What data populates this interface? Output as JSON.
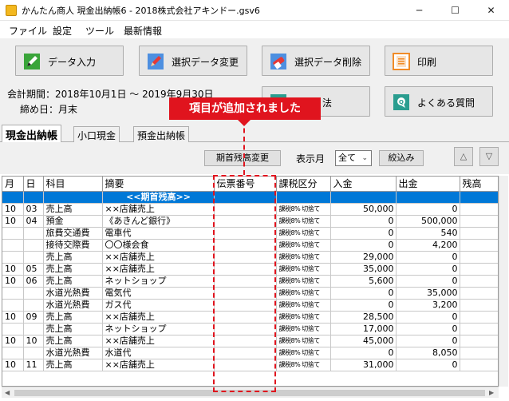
{
  "window": {
    "title": "かんたん商人 現金出納帳6 - 2018株式会社アキンドー.gsv6",
    "minimize": "─",
    "maximize": "☐",
    "close": "✕"
  },
  "menu": [
    "ファイル",
    "設定",
    "ツール",
    "最新情報"
  ],
  "toolbar": {
    "data_input": "データ入力",
    "edit_data": "選択データ変更",
    "delete_data": "選択データ削除",
    "print": "印刷",
    "settings_partial": "法",
    "faq": "よくある質問"
  },
  "info": {
    "period": "会計期間：2018年10月1日 〜 2019年9月30日",
    "closing": "締め日：月末"
  },
  "tabs": [
    "現金出納帳",
    "小口現金",
    "預金出納帳"
  ],
  "filter": {
    "opening_balance_button": "期首残高変更",
    "month_label": "表示月",
    "month_value": "全て",
    "narrow_button": "絞込み",
    "up": "△",
    "down": "▽"
  },
  "callout": {
    "text": "項目が追加されました"
  },
  "table": {
    "headers": [
      "月",
      "日",
      "科目",
      "摘要",
      "伝票番号",
      "課税区分",
      "入金",
      "出金",
      "残高"
    ],
    "rows": [
      [
        "",
        "",
        "",
        "<<期首残高>>",
        "",
        "",
        "",
        "",
        "1,00"
      ],
      [
        "10",
        "03",
        "売上高",
        "××店舗売上",
        "",
        "課税8% 切捨て",
        "50,000",
        "0",
        "1,05"
      ],
      [
        "10",
        "04",
        "預金",
        "《あきんど銀行》",
        "",
        "課税8% 切捨て",
        "0",
        "500,000",
        ""
      ],
      [
        "",
        "",
        "旅費交通費",
        "電車代",
        "",
        "課税8% 切捨て",
        "0",
        "540",
        ""
      ],
      [
        "",
        "",
        "接待交際費",
        "〇〇様会食",
        "",
        "課税8% 切捨て",
        "0",
        "4,200",
        ""
      ],
      [
        "",
        "",
        "売上高",
        "××店舗売上",
        "",
        "課税8% 切捨て",
        "29,000",
        "0",
        "57"
      ],
      [
        "10",
        "05",
        "売上高",
        "××店舗売上",
        "",
        "課税8% 切捨て",
        "35,000",
        "0",
        "60"
      ],
      [
        "10",
        "06",
        "売上高",
        "ネットショップ",
        "",
        "課税8% 切捨て",
        "5,600",
        "0",
        ""
      ],
      [
        "",
        "",
        "水道光熱費",
        "電気代",
        "",
        "課税8% 切捨て",
        "0",
        "35,000",
        ""
      ],
      [
        "",
        "",
        "水道光熱費",
        "ガス代",
        "",
        "課税8% 切捨て",
        "0",
        "3,200",
        "57"
      ],
      [
        "10",
        "09",
        "売上高",
        "××店舗売上",
        "",
        "課税8% 切捨て",
        "28,500",
        "0",
        ""
      ],
      [
        "",
        "",
        "売上高",
        "ネットショップ",
        "",
        "課税8% 切捨て",
        "17,000",
        "0",
        "62"
      ],
      [
        "10",
        "10",
        "売上高",
        "××店舗売上",
        "",
        "課税8% 切捨て",
        "45,000",
        "0",
        ""
      ],
      [
        "",
        "",
        "水道光熱費",
        "水道代",
        "",
        "課税8% 切捨て",
        "0",
        "8,050",
        "65"
      ],
      [
        "10",
        "11",
        "売上高",
        "××店舗売上",
        "",
        "課税8% 切捨て",
        "31,000",
        "0",
        "68"
      ]
    ]
  },
  "icons": {
    "app": "app-icon",
    "data_input": "pencil-icon",
    "edit": "pencil-icon",
    "delete": "eraser-icon",
    "print": "printer-icon",
    "faq": "question-icon"
  }
}
